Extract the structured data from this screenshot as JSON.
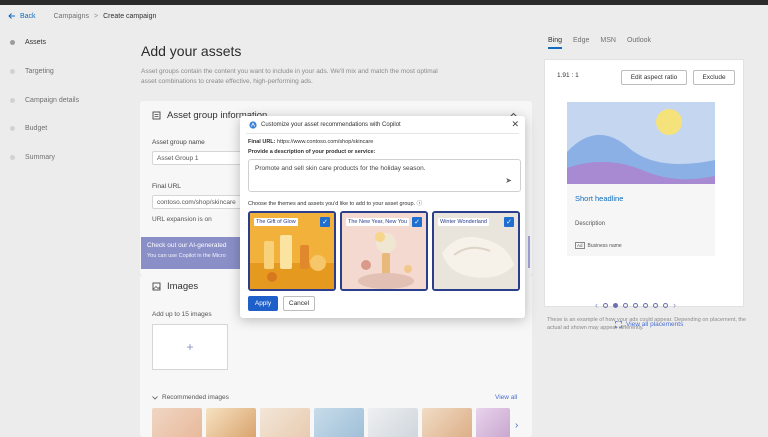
{
  "breadcrumb": {
    "back": "Back",
    "campaigns": "Campaigns",
    "separator": ">",
    "current": "Create campaign"
  },
  "nav": {
    "items": [
      "Assets",
      "Targeting",
      "Campaign details",
      "Budget",
      "Summary"
    ],
    "active": "Assets"
  },
  "main": {
    "title": "Add your assets",
    "intro": "Asset groups contain the content you want to include in your ads. We'll mix and match the most optimal asset combinations to create effective, high-performing ads.",
    "asset_group": {
      "title": "Asset group information",
      "name_label": "Asset group name",
      "name_value": "Asset Group 1",
      "url_label": "Final URL",
      "url_value": "contoso.com/shop/skincare",
      "expansion": "URL expansion is on"
    },
    "banner": {
      "line1": "Check out our AI-generated",
      "line2": "You can use Copilot in the Micro"
    },
    "images": {
      "title": "Images",
      "hint": "Add up to 15 images",
      "plus": "+",
      "recommended": "Recommended images",
      "view_all": "View all",
      "chevron": "›"
    }
  },
  "modal": {
    "title": "Customize your asset recommendations with Copilot",
    "close": "✕",
    "final_url_label": "Final URL:",
    "final_url": "https://www.contoso.com/shop/skincare",
    "desc_label": "Provide a description of your product or service:",
    "desc_value": "Promote and sell skin care products for the holiday season.",
    "send": "➤",
    "themes_label": "Choose the themes and assets you'd like to add to your asset group.",
    "info": "ⓘ",
    "themes": [
      {
        "name": "The Gift of Glow",
        "checked": true
      },
      {
        "name": "The New Year, New You",
        "checked": true
      },
      {
        "name": "Winter Wonderland",
        "checked": true
      }
    ],
    "check": "✓",
    "apply": "Apply",
    "cancel": "Cancel"
  },
  "preview": {
    "tabs": [
      "Bing",
      "Edge",
      "MSN",
      "Outlook"
    ],
    "active_tab": "Bing",
    "ratio": "1.91 : 1",
    "edit_ratio": "Edit aspect ratio",
    "exclude": "Exclude",
    "short_headline": "Short headline",
    "description": "Description",
    "ad_tag": "Ad",
    "business_name": "Business name",
    "prev": "‹",
    "next": "›",
    "page_count": 7,
    "current_page": 2,
    "view_all_placements": "View all placements",
    "note": "These is an example of how your ads could appear. Depending on placement, the actual ad shown may appear differently."
  }
}
